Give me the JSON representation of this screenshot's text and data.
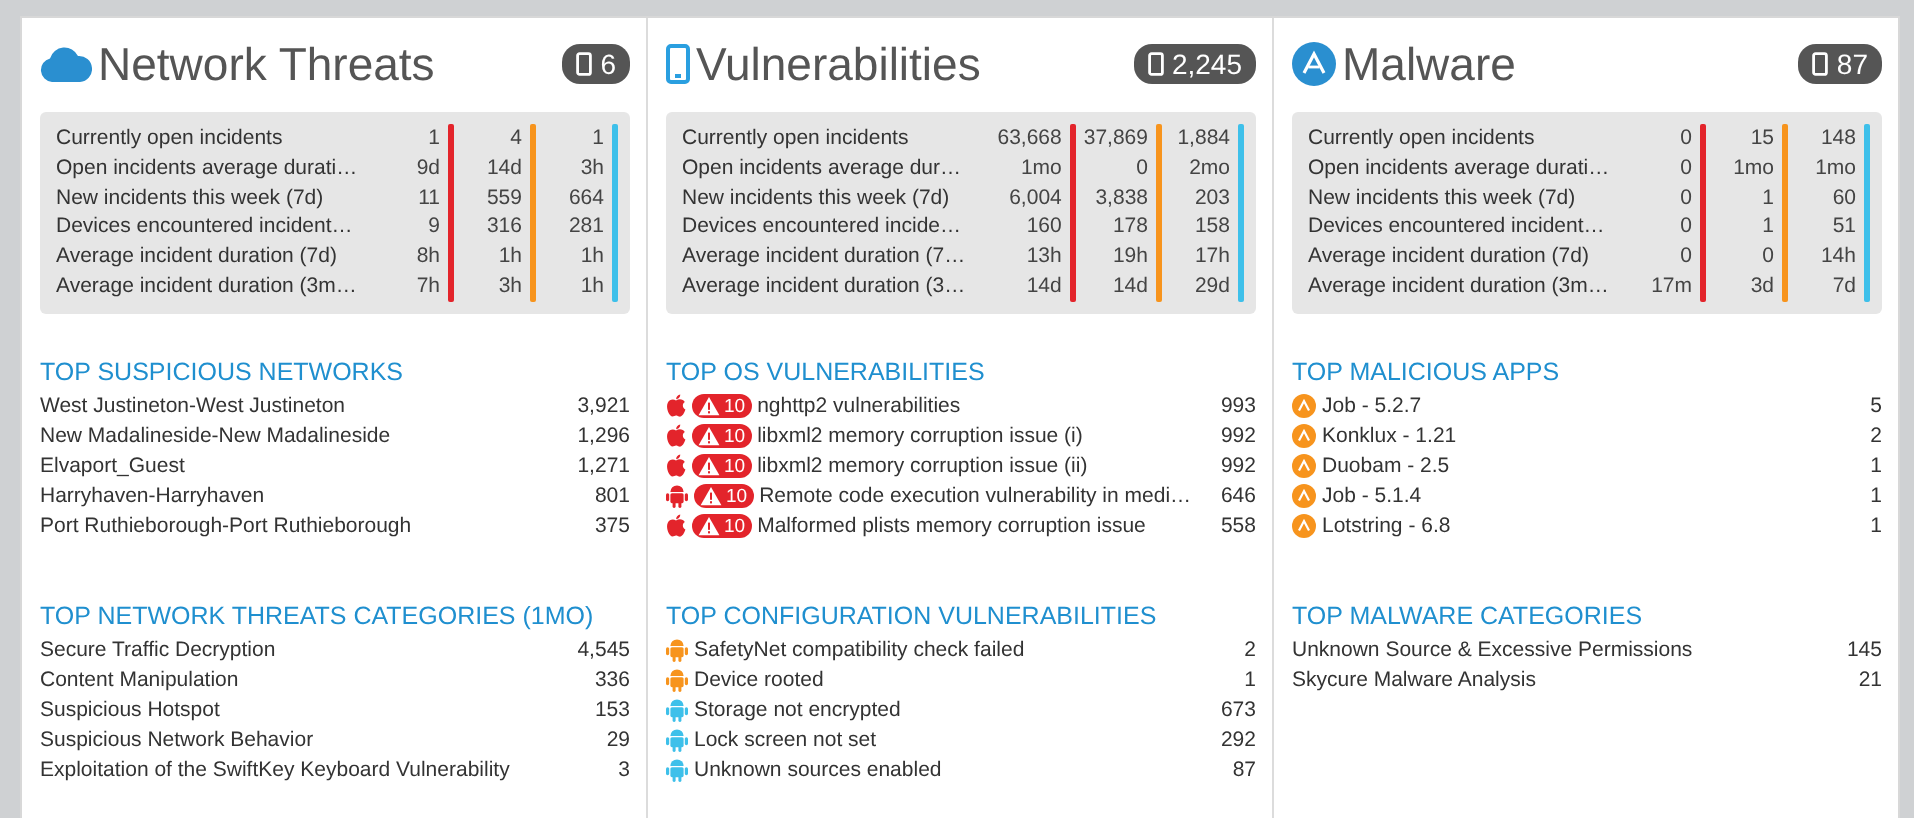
{
  "panels": [
    {
      "kind": "network",
      "title": "Network Threats",
      "device_count": "6",
      "stat_columns": [
        {
          "color": "#e3242b"
        },
        {
          "color": "#f7941d"
        },
        {
          "color": "#3ec0ea"
        }
      ],
      "stats": [
        {
          "label": "Currently open incidents",
          "values": [
            "1",
            "4",
            "1"
          ]
        },
        {
          "label": "Open incidents average durati…",
          "values": [
            "9d",
            "14d",
            "3h"
          ]
        },
        {
          "label": "New incidents this week (7d)",
          "values": [
            "11",
            "559",
            "664"
          ]
        },
        {
          "label": "Devices encountered incident…",
          "values": [
            "9",
            "316",
            "281"
          ]
        },
        {
          "label": "Average incident duration (7d)",
          "values": [
            "8h",
            "1h",
            "1h"
          ]
        },
        {
          "label": "Average incident duration (3m…",
          "values": [
            "7h",
            "3h",
            "1h"
          ]
        }
      ],
      "sections": [
        {
          "title": "TOP SUSPICIOUS NETWORKS",
          "items": [
            {
              "kind": "plain",
              "label": "West Justineton-West Justineton",
              "value": "3,921"
            },
            {
              "kind": "plain",
              "label": "New Madalineside-New Madalineside",
              "value": "1,296"
            },
            {
              "kind": "plain",
              "label": "Elvaport_Guest",
              "value": "1,271"
            },
            {
              "kind": "plain",
              "label": "Harryhaven-Harryhaven",
              "value": "801"
            },
            {
              "kind": "plain",
              "label": "Port Ruthieborough-Port Ruthieborough",
              "value": "375"
            }
          ]
        },
        {
          "title": "TOP NETWORK THREATS CATEGORIES (1MO)",
          "items": [
            {
              "kind": "plain",
              "label": "Secure Traffic Decryption",
              "value": "4,545"
            },
            {
              "kind": "plain",
              "label": "Content Manipulation",
              "value": "336"
            },
            {
              "kind": "plain",
              "label": "Suspicious Hotspot",
              "value": "153"
            },
            {
              "kind": "plain",
              "label": "Suspicious Network Behavior",
              "value": "29"
            },
            {
              "kind": "plain",
              "label": "Exploitation of the SwiftKey Keyboard Vulnerability",
              "value": "3"
            }
          ]
        }
      ]
    },
    {
      "kind": "device",
      "title": "Vulnerabilities",
      "device_count": "2,245",
      "stat_columns": [
        {
          "color": "#e3242b"
        },
        {
          "color": "#f7941d"
        },
        {
          "color": "#3ec0ea"
        }
      ],
      "stats": [
        {
          "label": "Currently open incidents",
          "values": [
            "63,668",
            "37,869",
            "1,884"
          ]
        },
        {
          "label": "Open incidents average dur…",
          "values": [
            "1mo",
            "0",
            "2mo"
          ]
        },
        {
          "label": "New incidents this week (7d)",
          "values": [
            "6,004",
            "3,838",
            "203"
          ]
        },
        {
          "label": "Devices encountered incide…",
          "values": [
            "160",
            "178",
            "158"
          ]
        },
        {
          "label": "Average incident duration (7…",
          "values": [
            "13h",
            "19h",
            "17h"
          ]
        },
        {
          "label": "Average incident duration (3…",
          "values": [
            "14d",
            "14d",
            "29d"
          ]
        }
      ],
      "sections": [
        {
          "title": "TOP OS VULNERABILITIES",
          "items": [
            {
              "kind": "apple_os",
              "severity": "10",
              "label": "nghttp2 vulnerabilities",
              "value": "993"
            },
            {
              "kind": "apple_os",
              "severity": "10",
              "label": "libxml2 memory corruption issue (i)",
              "value": "992"
            },
            {
              "kind": "apple_os",
              "severity": "10",
              "label": "libxml2 memory corruption issue (ii)",
              "value": "992"
            },
            {
              "kind": "android_os",
              "severity": "10",
              "label": "Remote code execution vulnerability in medi…",
              "value": "646"
            },
            {
              "kind": "apple_os",
              "severity": "10",
              "label": "Malformed plists memory corruption issue",
              "value": "558"
            }
          ]
        },
        {
          "title": "TOP CONFIGURATION VULNERABILITIES",
          "items": [
            {
              "kind": "config",
              "color": "#f7941d",
              "label": "SafetyNet compatibility check failed",
              "value": "2"
            },
            {
              "kind": "config",
              "color": "#f7941d",
              "label": "Device rooted",
              "value": "1"
            },
            {
              "kind": "config",
              "color": "#3ec0ea",
              "label": "Storage not encrypted",
              "value": "673"
            },
            {
              "kind": "config",
              "color": "#3ec0ea",
              "label": "Lock screen not set",
              "value": "292"
            },
            {
              "kind": "config",
              "color": "#3ec0ea",
              "label": "Unknown sources enabled",
              "value": "87"
            }
          ]
        }
      ]
    },
    {
      "kind": "app",
      "title": "Malware",
      "device_count": "87",
      "stat_columns": [
        {
          "color": "#e3242b"
        },
        {
          "color": "#f7941d"
        },
        {
          "color": "#3ec0ea"
        }
      ],
      "stats": [
        {
          "label": "Currently open incidents",
          "values": [
            "0",
            "15",
            "148"
          ]
        },
        {
          "label": "Open incidents average durati…",
          "values": [
            "0",
            "1mo",
            "1mo"
          ]
        },
        {
          "label": "New incidents this week (7d)",
          "values": [
            "0",
            "1",
            "60"
          ]
        },
        {
          "label": "Devices encountered incident…",
          "values": [
            "0",
            "1",
            "51"
          ]
        },
        {
          "label": "Average incident duration (7d)",
          "values": [
            "0",
            "0",
            "14h"
          ]
        },
        {
          "label": "Average incident duration (3m…",
          "values": [
            "17m",
            "3d",
            "7d"
          ]
        }
      ],
      "sections": [
        {
          "title": "TOP MALICIOUS APPS",
          "items": [
            {
              "kind": "app",
              "label": "Job - 5.2.7",
              "value": "5"
            },
            {
              "kind": "app",
              "label": "Konklux - 1.21",
              "value": "2"
            },
            {
              "kind": "app",
              "label": "Duobam - 2.5",
              "value": "1"
            },
            {
              "kind": "app",
              "label": "Job - 5.1.4",
              "value": "1"
            },
            {
              "kind": "app",
              "label": "Lotstring - 6.8",
              "value": "1"
            }
          ]
        },
        {
          "title": "TOP MALWARE CATEGORIES",
          "items": [
            {
              "kind": "plain",
              "label": "Unknown Source & Excessive Permissions",
              "value": "145"
            },
            {
              "kind": "plain",
              "label": "Skycure Malware Analysis",
              "value": "21"
            }
          ]
        }
      ]
    }
  ]
}
